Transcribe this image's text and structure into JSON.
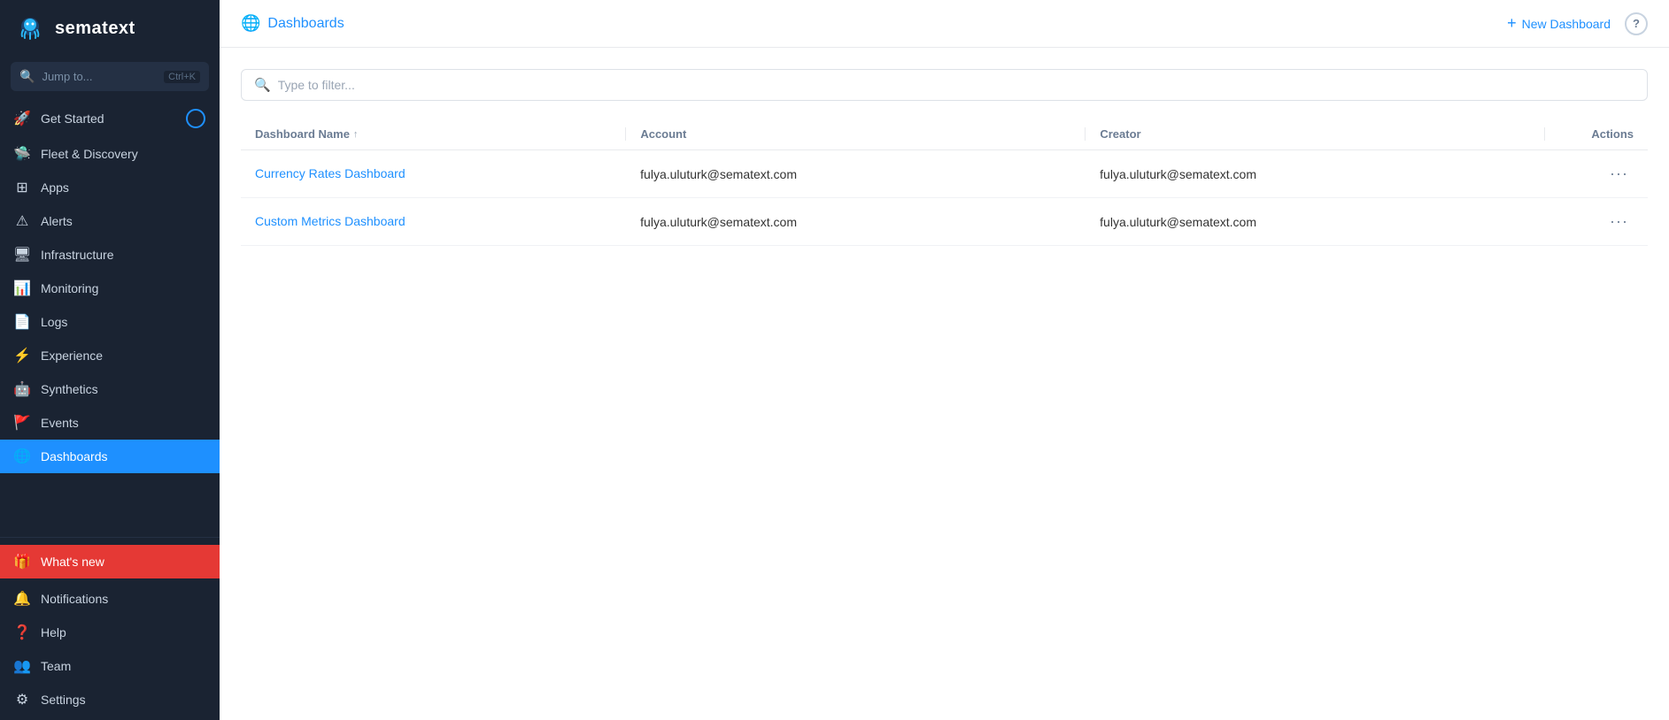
{
  "sidebar": {
    "logo_text": "sematext",
    "search_placeholder": "Jump to...",
    "search_shortcut": "Ctrl+K",
    "nav_items": [
      {
        "id": "get-started",
        "label": "Get Started",
        "icon": "🚀",
        "active": false,
        "badge": true
      },
      {
        "id": "fleet-discovery",
        "label": "Fleet & Discovery",
        "icon": "🛸",
        "active": false
      },
      {
        "id": "apps",
        "label": "Apps",
        "icon": "⊞",
        "active": false
      },
      {
        "id": "alerts",
        "label": "Alerts",
        "icon": "⚠",
        "active": false
      },
      {
        "id": "infrastructure",
        "label": "Infrastructure",
        "icon": "🖥",
        "active": false
      },
      {
        "id": "monitoring",
        "label": "Monitoring",
        "icon": "📊",
        "active": false
      },
      {
        "id": "logs",
        "label": "Logs",
        "icon": "📄",
        "active": false
      },
      {
        "id": "experience",
        "label": "Experience",
        "icon": "⚡",
        "active": false
      },
      {
        "id": "synthetics",
        "label": "Synthetics",
        "icon": "🤖",
        "active": false
      },
      {
        "id": "events",
        "label": "Events",
        "icon": "🚩",
        "active": false
      },
      {
        "id": "dashboards",
        "label": "Dashboards",
        "icon": "🌐",
        "active": true
      }
    ],
    "bottom_items": [
      {
        "id": "whats-new",
        "label": "What's new",
        "icon": "🎁",
        "special": "red"
      },
      {
        "id": "notifications",
        "label": "Notifications",
        "icon": "🔔"
      },
      {
        "id": "help",
        "label": "Help",
        "icon": "❓"
      },
      {
        "id": "team",
        "label": "Team",
        "icon": "👥"
      },
      {
        "id": "settings",
        "label": "Settings",
        "icon": "⚙"
      }
    ]
  },
  "topbar": {
    "breadcrumb": "Dashboards",
    "new_dashboard_label": "New Dashboard",
    "help_tooltip": "?"
  },
  "content": {
    "filter_placeholder": "Type to filter...",
    "table": {
      "columns": [
        {
          "id": "name",
          "label": "Dashboard Name",
          "sort": "↑"
        },
        {
          "id": "account",
          "label": "Account"
        },
        {
          "id": "creator",
          "label": "Creator"
        },
        {
          "id": "actions",
          "label": "Actions"
        }
      ],
      "rows": [
        {
          "name": "Currency Rates Dashboard",
          "account": "fulya.uluturk@sematext.com",
          "creator": "fulya.uluturk@sematext.com"
        },
        {
          "name": "Custom Metrics Dashboard",
          "account": "fulya.uluturk@sematext.com",
          "creator": "fulya.uluturk@sematext.com"
        }
      ]
    }
  }
}
